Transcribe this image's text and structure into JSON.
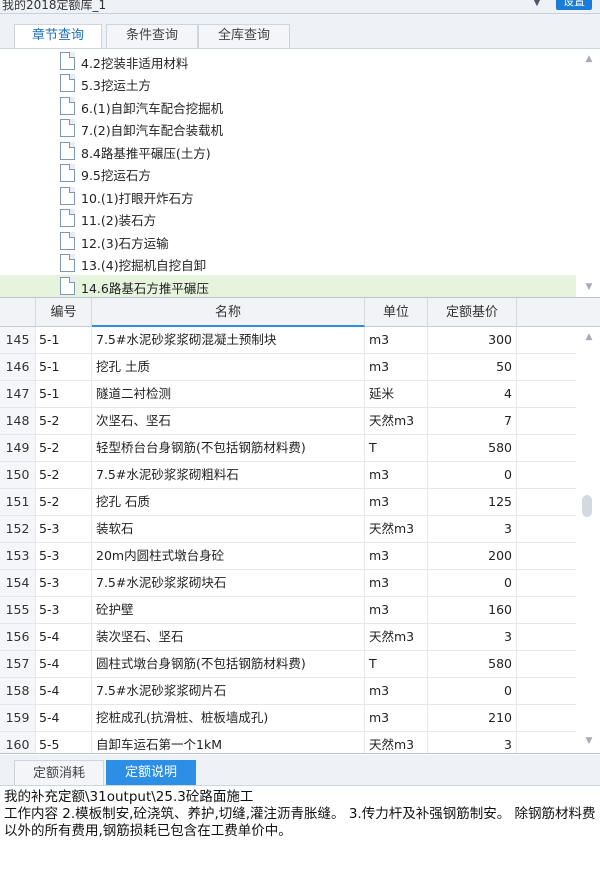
{
  "top": {
    "library_name": "我的2018定额库_1",
    "settings_label": "设置"
  },
  "query_tabs": [
    {
      "label": "章节查询",
      "active": true
    },
    {
      "label": "条件查询",
      "active": false
    },
    {
      "label": "全库查询",
      "active": false
    }
  ],
  "tree": {
    "items": [
      {
        "label": "4.2挖装非适用材料",
        "selected": false
      },
      {
        "label": "5.3挖运土方",
        "selected": false
      },
      {
        "label": "6.(1)自卸汽车配合挖掘机",
        "selected": false
      },
      {
        "label": "7.(2)自卸汽车配合装载机",
        "selected": false
      },
      {
        "label": "8.4路基推平碾压(土方)",
        "selected": false
      },
      {
        "label": "9.5挖运石方",
        "selected": false
      },
      {
        "label": "10.(1)打眼开炸石方",
        "selected": false
      },
      {
        "label": "11.(2)装石方",
        "selected": false
      },
      {
        "label": "12.(3)石方运输",
        "selected": false
      },
      {
        "label": "13.(4)挖掘机自挖自卸",
        "selected": false
      },
      {
        "label": "14.6路基石方推平碾压",
        "selected": true
      }
    ]
  },
  "grid": {
    "columns": [
      "编号",
      "名称",
      "单位",
      "定额基价"
    ],
    "rows": [
      {
        "idx": "145",
        "code": "5-1",
        "name": "7.5#水泥砂浆浆砌混凝土预制块",
        "unit": "m3",
        "price": "300"
      },
      {
        "idx": "146",
        "code": "5-1",
        "name": "挖孔 土质",
        "unit": "m3",
        "price": "50"
      },
      {
        "idx": "147",
        "code": "5-1",
        "name": "隧道二衬检测",
        "unit": "延米",
        "price": "4"
      },
      {
        "idx": "148",
        "code": "5-2",
        "name": "次坚石、坚石",
        "unit": "天然m3",
        "price": "7"
      },
      {
        "idx": "149",
        "code": "5-2",
        "name": "轻型桥台台身钢筋(不包括钢筋材料费)",
        "unit": "T",
        "price": "580"
      },
      {
        "idx": "150",
        "code": "5-2",
        "name": "7.5#水泥砂浆浆砌粗料石",
        "unit": "m3",
        "price": "0"
      },
      {
        "idx": "151",
        "code": "5-2",
        "name": "挖孔 石质",
        "unit": "m3",
        "price": "125"
      },
      {
        "idx": "152",
        "code": "5-3",
        "name": "装软石",
        "unit": "天然m3",
        "price": "3"
      },
      {
        "idx": "153",
        "code": "5-3",
        "name": "20m内圆柱式墩台身砼",
        "unit": "m3",
        "price": "200"
      },
      {
        "idx": "154",
        "code": "5-3",
        "name": "7.5#水泥砂浆浆砌块石",
        "unit": "m3",
        "price": "0"
      },
      {
        "idx": "155",
        "code": "5-3",
        "name": "砼护壁",
        "unit": "m3",
        "price": "160"
      },
      {
        "idx": "156",
        "code": "5-4",
        "name": "装次坚石、坚石",
        "unit": "天然m3",
        "price": "3"
      },
      {
        "idx": "157",
        "code": "5-4",
        "name": "圆柱式墩台身钢筋(不包括钢筋材料费)",
        "unit": "T",
        "price": "580"
      },
      {
        "idx": "158",
        "code": "5-4",
        "name": "7.5#水泥砂浆浆砌片石",
        "unit": "m3",
        "price": "0"
      },
      {
        "idx": "159",
        "code": "5-4",
        "name": "挖桩成孔(抗滑桩、桩板墙成孔)",
        "unit": "m3",
        "price": "210"
      },
      {
        "idx": "160",
        "code": "5-5",
        "name": "自卸车运石第一个1kM",
        "unit": "天然m3",
        "price": "3"
      }
    ]
  },
  "bottom_tabs": [
    {
      "label": "定额消耗",
      "active": false
    },
    {
      "label": "定额说明",
      "active": true
    }
  ],
  "description": {
    "line1": "我的补充定额\\31output\\25.3砼路面施工",
    "line2": "工作内容 2.模板制安,砼浇筑、养护,切缝,灌注沥青胀缝。 3.传力杆及补强钢筋制安。 除钢筋材料费以外的所有费用,钢筋损耗已包含在工费单价中。"
  },
  "colors": {
    "accent": "#2d8ee6",
    "selected_row": "#e7f4dd",
    "header_bg": "#f1f3f6"
  }
}
